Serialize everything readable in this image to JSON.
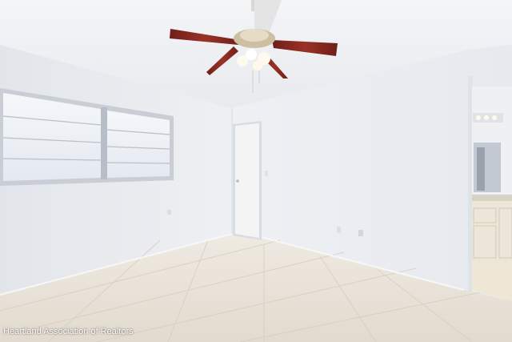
{
  "photo": {
    "subject": "empty-room-with-ceiling-fan",
    "colors": {
      "wall": "#eceef2",
      "ceiling": "#f2f3f5",
      "floor": "#e8e1d4",
      "fan_blade": "#8a2a22",
      "door": "#f4f4f4",
      "cabinet": "#ece6d8"
    }
  },
  "watermark": {
    "text": "Heartland Association of Realtors"
  }
}
